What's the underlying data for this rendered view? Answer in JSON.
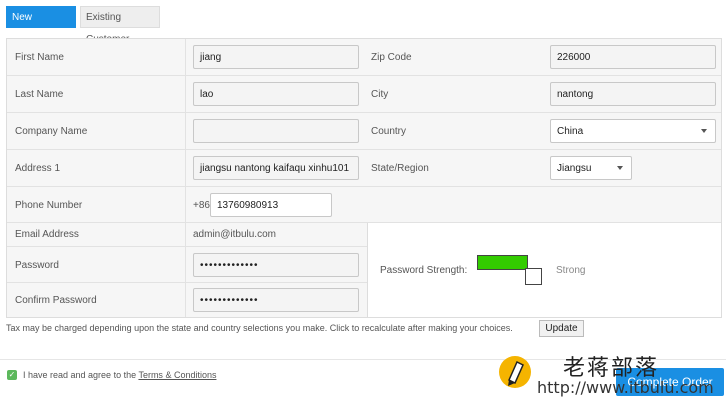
{
  "tabs": {
    "new_customer": "New Customer",
    "existing_customer": "Existing Customer"
  },
  "fields": {
    "first_name": {
      "label": "First Name",
      "value": "jiang"
    },
    "zip_code": {
      "label": "Zip Code",
      "value": "226000"
    },
    "last_name": {
      "label": "Last Name",
      "value": "lao"
    },
    "city": {
      "label": "City",
      "value": "nantong"
    },
    "company_name": {
      "label": "Company Name",
      "value": ""
    },
    "country": {
      "label": "Country",
      "value": "China"
    },
    "address1": {
      "label": "Address 1",
      "value": "jiangsu nantong kaifaqu xinhu101"
    },
    "state_region": {
      "label": "State/Region",
      "value": "Jiangsu"
    },
    "phone": {
      "label": "Phone Number",
      "prefix": "+86",
      "value": "13760980913"
    },
    "email": {
      "label": "Email Address",
      "value": "admin@itbulu.com"
    },
    "password": {
      "label": "Password",
      "value": "•••••••••••••"
    },
    "confirm_password": {
      "label": "Confirm Password",
      "value": "•••••••••••••"
    }
  },
  "password_strength": {
    "label": "Password Strength:",
    "text": "Strong",
    "color": "#33cc00"
  },
  "tax_note": "Tax may be charged depending upon the state and country selections you make. Click to recalculate after making your choices.",
  "update_button": "Update",
  "agree": {
    "text": "I have read and agree to the",
    "link": "Terms & Conditions"
  },
  "complete_button": "Complete Order",
  "watermark": {
    "cn_text": "老蒋部落",
    "url": "http://www.itbulu.com"
  },
  "colors": {
    "accent": "#1a8fe3",
    "check": "#5cb85c"
  }
}
